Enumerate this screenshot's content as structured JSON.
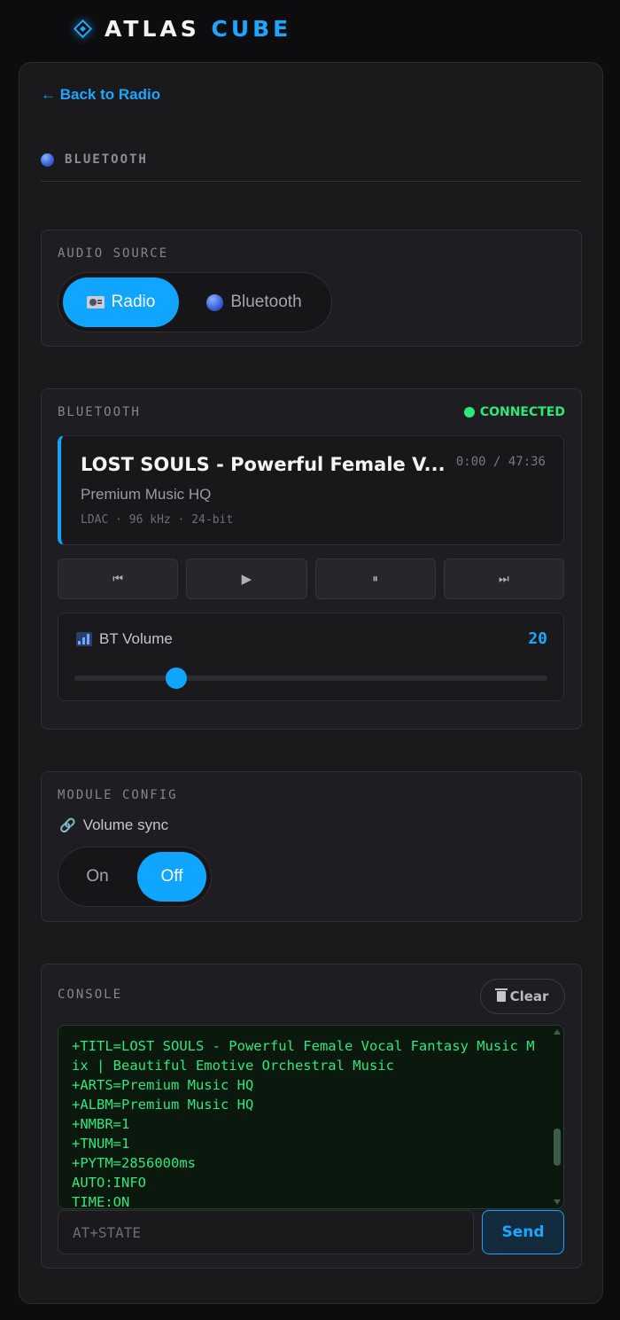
{
  "brand": {
    "word1": "ATLAS",
    "word2": "CUBE",
    "icon": "diamond-logo-icon"
  },
  "nav": {
    "back_label": "← Back to Radio"
  },
  "section": {
    "title": "BLUETOOTH",
    "icon": "bluetooth-ball-icon"
  },
  "audio_source": {
    "label": "AUDIO SOURCE",
    "options": [
      {
        "label": "Radio",
        "icon": "radio-icon",
        "active": true
      },
      {
        "label": "Bluetooth",
        "icon": "bluetooth-ball-icon",
        "active": false
      }
    ]
  },
  "bluetooth": {
    "label": "BLUETOOTH",
    "status": "CONNECTED",
    "status_color": "#2ee87a",
    "track": {
      "title": "LOST SOULS - Powerful Female V...",
      "time": "0:00 / 47:36",
      "artist": "Premium Music HQ",
      "meta": "LDAC · 96 kHz · 24-bit"
    },
    "controls": [
      {
        "name": "previous-button",
        "glyph": "⏮",
        "icon": "skip-back-icon"
      },
      {
        "name": "play-button",
        "glyph": "▶",
        "icon": "play-icon"
      },
      {
        "name": "pause-button",
        "glyph": "⏸",
        "icon": "pause-icon"
      },
      {
        "name": "next-button",
        "glyph": "⏭",
        "icon": "skip-forward-icon"
      }
    ],
    "volume": {
      "label": "BT Volume",
      "value": "20",
      "fraction": 0.215,
      "icon": "signal-bars-icon"
    }
  },
  "module_config": {
    "label": "MODULE CONFIG",
    "volume_sync_label": "Volume sync",
    "icon": "link-icon",
    "options": [
      {
        "label": "On",
        "active": false
      },
      {
        "label": "Off",
        "active": true
      }
    ]
  },
  "console": {
    "label": "CONSOLE",
    "clear_label": "Clear",
    "lines": "+TITL=LOST SOULS - Powerful Female Vocal Fantasy Music Mix | Beautiful Emotive Orchestral Music\n+ARTS=Premium Music HQ\n+ALBM=Premium Music HQ\n+NMBR=1\n+TNUM=1\n+PYTM=2856000ms\nAUTO:INFO\nTIME:ON",
    "input_placeholder": "AT+STATE",
    "send_label": "Send"
  },
  "colors": {
    "accent": "#10a5ff",
    "background": "#0d0d0f",
    "console_text": "#2ee87a"
  }
}
